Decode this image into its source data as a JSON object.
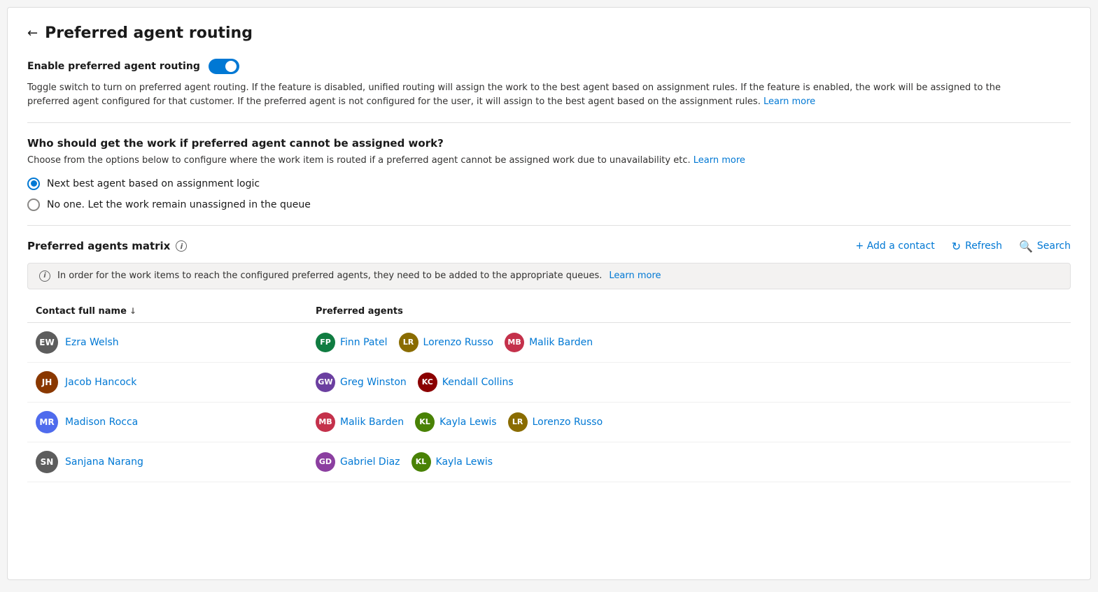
{
  "page": {
    "title": "Preferred agent routing",
    "back_label": "←"
  },
  "toggle_section": {
    "label": "Enable preferred agent routing",
    "enabled": true,
    "description": "Toggle switch to turn on preferred agent routing. If the feature is disabled, unified routing will assign the work to the best agent based on assignment rules. If the feature is enabled, the work will be assigned to the preferred agent configured for that customer. If the preferred agent is not configured for the user, it will assign to the best agent based on the assignment rules.",
    "learn_more": "Learn more"
  },
  "routing_section": {
    "title": "Who should get the work if preferred agent cannot be assigned work?",
    "description": "Choose from the options below to configure where the work item is routed if a preferred agent cannot be assigned work due to unavailability etc.",
    "learn_more": "Learn more",
    "options": [
      {
        "id": "next_best",
        "label": "Next best agent based on assignment logic",
        "selected": true
      },
      {
        "id": "no_one",
        "label": "No one. Let the work remain unassigned in the queue",
        "selected": false
      }
    ]
  },
  "matrix_section": {
    "title": "Preferred agents matrix",
    "info_tooltip": "i",
    "actions": {
      "add_contact": "+ Add a contact",
      "refresh": "Refresh",
      "search": "Search"
    },
    "info_banner": "In order for the work items to reach the configured preferred agents, they need to be added to the appropriate queues.",
    "info_banner_learn_more": "Learn more",
    "table": {
      "columns": [
        {
          "id": "contact",
          "label": "Contact full name",
          "sortable": true
        },
        {
          "id": "agents",
          "label": "Preferred agents",
          "sortable": false
        }
      ],
      "rows": [
        {
          "contact": {
            "initials": "EW",
            "name": "Ezra Welsh",
            "color": "#5d5d5d"
          },
          "agents": [
            {
              "initials": "FP",
              "name": "Finn Patel",
              "color": "#107c41"
            },
            {
              "initials": "LR",
              "name": "Lorenzo Russo",
              "color": "#8a6c00"
            },
            {
              "initials": "MB",
              "name": "Malik Barden",
              "color": "#c4314b"
            }
          ]
        },
        {
          "contact": {
            "initials": "JH",
            "name": "Jacob Hancock",
            "color": "#8a3800"
          },
          "agents": [
            {
              "initials": "GW",
              "name": "Greg Winston",
              "color": "#6b3fa0"
            },
            {
              "initials": "KC",
              "name": "Kendall Collins",
              "color": "#8b0000"
            }
          ]
        },
        {
          "contact": {
            "initials": "MR",
            "name": "Madison Rocca",
            "color": "#4f6bed"
          },
          "agents": [
            {
              "initials": "MB",
              "name": "Malik Barden",
              "color": "#c4314b"
            },
            {
              "initials": "KL",
              "name": "Kayla Lewis",
              "color": "#498205"
            },
            {
              "initials": "LR",
              "name": "Lorenzo Russo",
              "color": "#8a6c00"
            }
          ]
        },
        {
          "contact": {
            "initials": "SN",
            "name": "Sanjana Narang",
            "color": "#5d5d5d"
          },
          "agents": [
            {
              "initials": "GD",
              "name": "Gabriel Diaz",
              "color": "#8b3fa0"
            },
            {
              "initials": "KL",
              "name": "Kayla Lewis",
              "color": "#498205"
            }
          ]
        }
      ]
    }
  }
}
